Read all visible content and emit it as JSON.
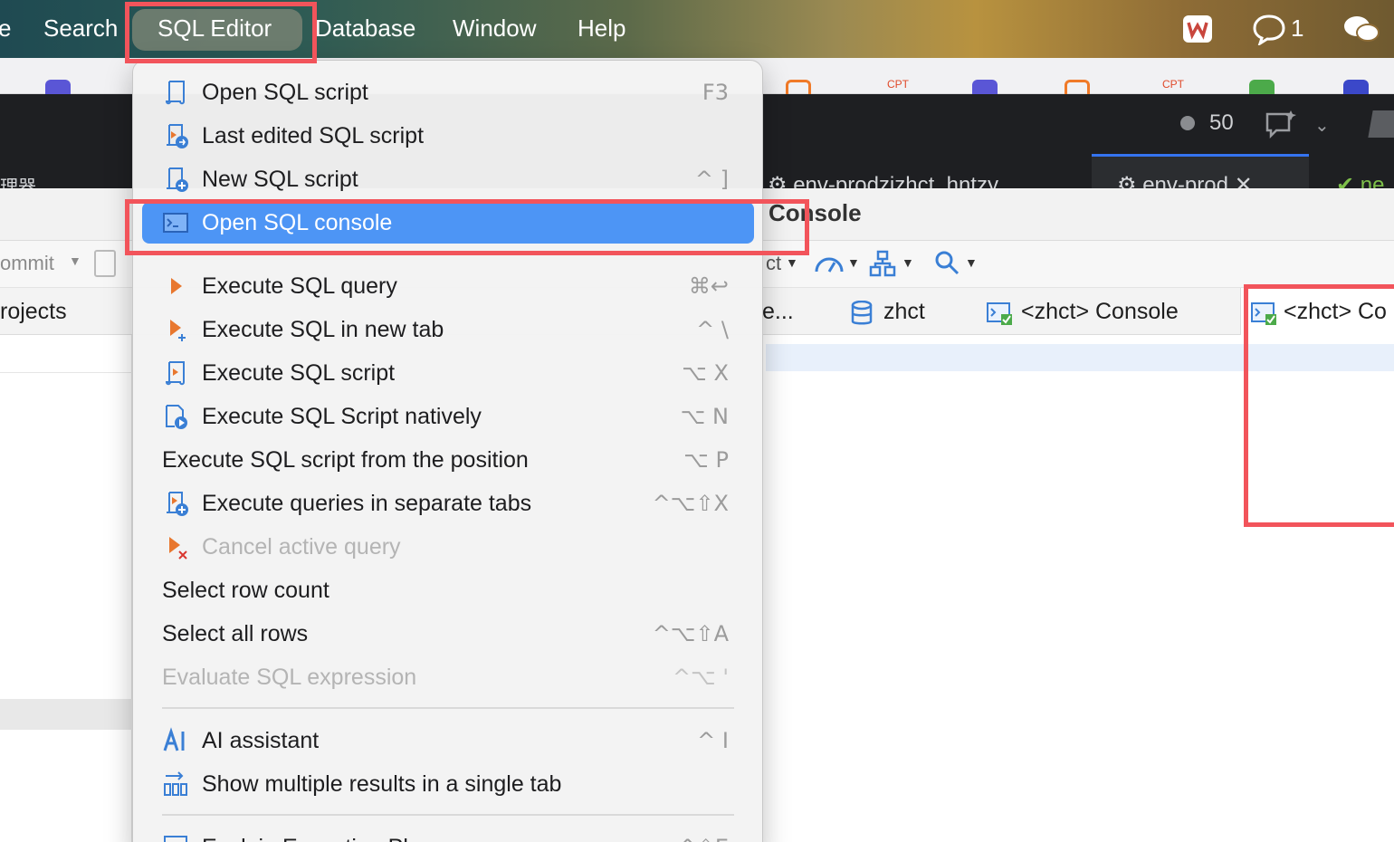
{
  "menubar": {
    "partial_left": "e",
    "items": [
      "Search",
      "SQL Editor",
      "Database",
      "Window",
      "Help"
    ],
    "active": "SQL Editor",
    "chat_count": "1"
  },
  "editor_tabs": {
    "left_partial": "理器",
    "tab_a": "env-prodzjzhct_hntzy",
    "tab_b": "env-prod",
    "tab_c": "ne"
  },
  "darkbar": {
    "counter": "50"
  },
  "workspace": {
    "title": "Console",
    "left_toolbar_label": "ommit",
    "left_panel_title": "rojects",
    "toolbar_partial": "ct",
    "tabs": [
      {
        "label": "e...",
        "icon": "ellipsis"
      },
      {
        "label": "zhct",
        "icon": "database-icon"
      },
      {
        "label": "<zhct> Console",
        "icon": "console-icon"
      },
      {
        "label": "<zhct> Co",
        "icon": "console-icon"
      }
    ]
  },
  "menu": {
    "items": [
      {
        "label": "Open SQL script",
        "shortcut": "F3",
        "icon": "script-icon",
        "disabled": false,
        "highlight": false
      },
      {
        "label": "Last edited SQL script",
        "shortcut": "",
        "icon": "script-recent-icon",
        "disabled": false,
        "highlight": false
      },
      {
        "label": "New SQL script",
        "shortcut": "^ ]",
        "icon": "script-new-icon",
        "disabled": false,
        "highlight": false
      },
      {
        "label": "Open SQL console",
        "shortcut": "",
        "icon": "console-icon",
        "disabled": false,
        "highlight": true
      },
      {
        "label": "Execute SQL query",
        "shortcut": "⌘↩",
        "icon": "run-icon",
        "disabled": false,
        "highlight": false
      },
      {
        "label": "Execute SQL in new tab",
        "shortcut": "^ \\",
        "icon": "run-new-tab-icon",
        "disabled": false,
        "highlight": false
      },
      {
        "label": "Execute SQL script",
        "shortcut": "⌥ X",
        "icon": "script-run-icon",
        "disabled": false,
        "highlight": false
      },
      {
        "label": "Execute SQL Script natively",
        "shortcut": "⌥ N",
        "icon": "script-native-icon",
        "disabled": false,
        "highlight": false
      },
      {
        "label": "Execute SQL script from the position",
        "shortcut": "⌥ P",
        "icon": "",
        "disabled": false,
        "highlight": false
      },
      {
        "label": "Execute queries in separate tabs",
        "shortcut": "^⌥⇧X",
        "icon": "script-tabs-icon",
        "disabled": false,
        "highlight": false
      },
      {
        "label": "Cancel active query",
        "shortcut": "",
        "icon": "cancel-icon",
        "disabled": true,
        "highlight": false
      },
      {
        "label": "Select row count",
        "shortcut": "",
        "icon": "",
        "disabled": false,
        "highlight": false
      },
      {
        "label": "Select all rows",
        "shortcut": "^⌥⇧A",
        "icon": "",
        "disabled": false,
        "highlight": false
      },
      {
        "label": "Evaluate SQL expression",
        "shortcut": "^⌥ '",
        "icon": "",
        "disabled": true,
        "highlight": false
      },
      {
        "label": "AI assistant",
        "shortcut": "^ I",
        "icon": "ai-icon",
        "disabled": false,
        "highlight": false
      },
      {
        "label": "Show multiple results in a single tab",
        "shortcut": "",
        "icon": "results-icon",
        "disabled": false,
        "highlight": false
      },
      {
        "label": "Explain Execution Plan",
        "shortcut": "^⇧E",
        "icon": "plan-icon",
        "disabled": false,
        "highlight": false
      }
    ]
  },
  "colors": {
    "highlight": "#4d95f5",
    "annotation": "#f2545b",
    "run_orange": "#e8772e",
    "icon_blue": "#3a7fd5"
  }
}
